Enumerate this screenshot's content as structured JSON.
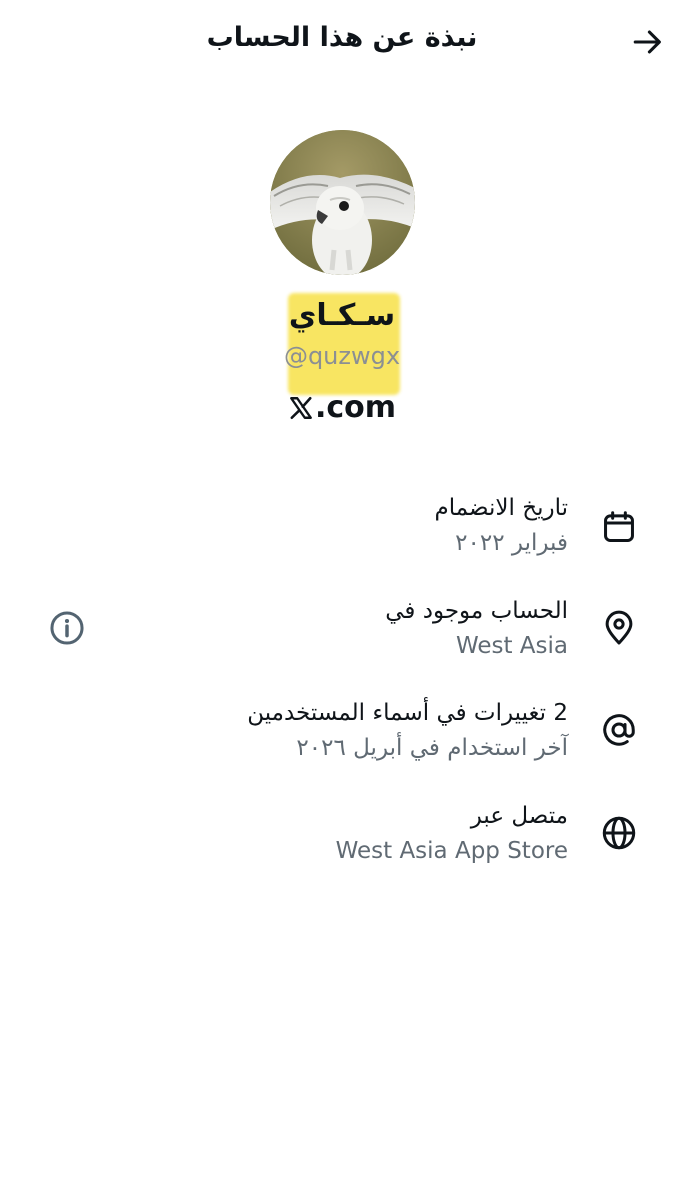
{
  "header": {
    "title": "نبذة عن هذا الحساب",
    "back_icon": "arrow-right-icon"
  },
  "profile": {
    "display_name": "سـكـاي",
    "handle": "@quzwgx",
    "site_suffix": ".com",
    "avatar_icon": "falcon-avatar"
  },
  "rows": [
    {
      "icon": "calendar-icon",
      "title": "تاريخ الانضمام",
      "subtitle": "فبراير ٢٠٢٢"
    },
    {
      "icon": "location-pin-icon",
      "title": "الحساب موجود في",
      "subtitle": "West Asia",
      "has_info": true
    },
    {
      "icon": "at-sign-icon",
      "title": "2 تغييرات في أسماء المستخدمين",
      "subtitle": "آخر استخدام في أبريل ٢٠٢٦"
    },
    {
      "icon": "globe-icon",
      "title": "متصل عبر",
      "subtitle": "West Asia App Store"
    }
  ],
  "colors": {
    "primary_text": "#0f1419",
    "secondary_text": "#606a73",
    "highlight": "#f8e45a"
  }
}
